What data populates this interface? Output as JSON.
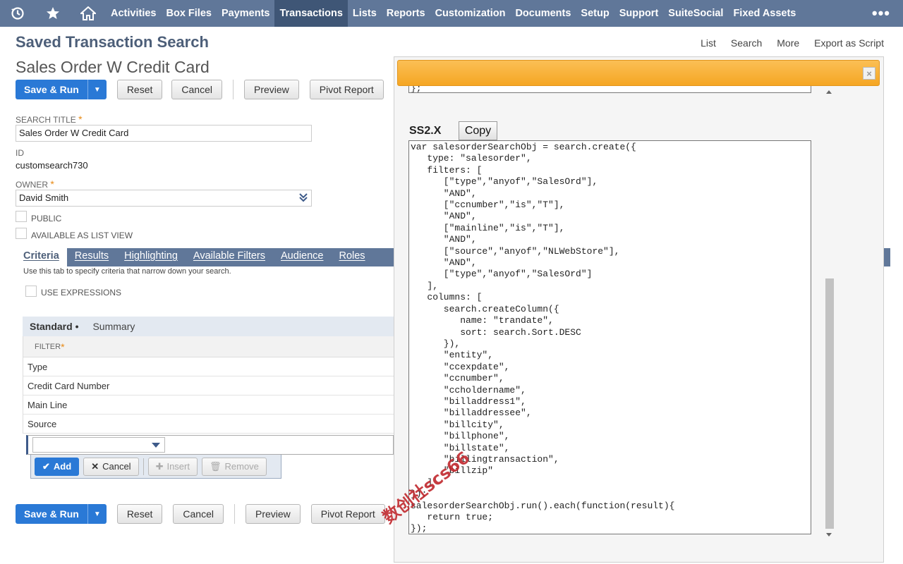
{
  "nav": {
    "icons": [
      "recent-icon",
      "star-icon",
      "home-icon"
    ],
    "items": [
      "Activities",
      "Box Files",
      "Payments",
      "Transactions",
      "Lists",
      "Reports",
      "Customization",
      "Documents",
      "Setup",
      "Support",
      "SuiteSocial",
      "Fixed Assets"
    ],
    "active": "Transactions",
    "more": "•••"
  },
  "header": {
    "page_title": "Saved Transaction Search",
    "record_title": "Sales Order W Credit Card",
    "links": [
      "List",
      "Search",
      "More",
      "Export as Script"
    ]
  },
  "buttons": {
    "save_run": "Save & Run",
    "reset": "Reset",
    "cancel": "Cancel",
    "preview": "Preview",
    "pivot_report": "Pivot Report"
  },
  "form": {
    "search_title_label": "SEARCH TITLE",
    "search_title_value": "Sales Order W Credit Card",
    "id_label": "ID",
    "id_value": "customsearch730",
    "owner_label": "OWNER",
    "owner_value": "David Smith",
    "public_label": "PUBLIC",
    "available_label": "AVAILABLE AS LIST VIEW",
    "required_mark": "*"
  },
  "tabs": {
    "items": [
      "Criteria",
      "Results",
      "Highlighting",
      "Available Filters",
      "Audience",
      "Roles"
    ],
    "active": "Criteria",
    "description": "Use this tab to specify criteria that narrow down your search.",
    "use_expressions": "USE EXPRESSIONS"
  },
  "criteria": {
    "subtabs": [
      "Standard •",
      "Summary"
    ],
    "filter_header": "FILTER",
    "filters": [
      "Type",
      "Credit Card Number",
      "Main Line",
      "Source"
    ],
    "actions": {
      "add": "Add",
      "cancel": "Cancel",
      "insert": "Insert",
      "remove": "Remove"
    }
  },
  "popup": {
    "prev_code_tail": "};",
    "section_label": "SS2.X",
    "copy_label": "Copy",
    "code": "var salesorderSearchObj = search.create({\n   type: \"salesorder\",\n   filters: [\n      [\"type\",\"anyof\",\"SalesOrd\"],\n      \"AND\",\n      [\"ccnumber\",\"is\",\"T\"],\n      \"AND\",\n      [\"mainline\",\"is\",\"T\"],\n      \"AND\",\n      [\"source\",\"anyof\",\"NLWebStore\"],\n      \"AND\",\n      [\"type\",\"anyof\",\"SalesOrd\"]\n   ],\n   columns: [\n      search.createColumn({\n         name: \"trandate\",\n         sort: search.Sort.DESC\n      }),\n      \"entity\",\n      \"ccexpdate\",\n      \"ccnumber\",\n      \"ccholdername\",\n      \"billaddress1\",\n      \"billaddressee\",\n      \"billcity\",\n      \"billphone\",\n      \"billstate\",\n      \"billingtransaction\",\n      \"billzip\"\n   ]\n});\nsalesorderSearchObj.run().each(function(result){\n   return true;\n});",
    "close_label": "×"
  },
  "watermark": "数创社scs66",
  "colors": {
    "nav": "#607799",
    "nav_active": "#3f5676",
    "primary": "#2a79d6",
    "popup_bar": "#f5a623",
    "required": "#e88a15"
  }
}
